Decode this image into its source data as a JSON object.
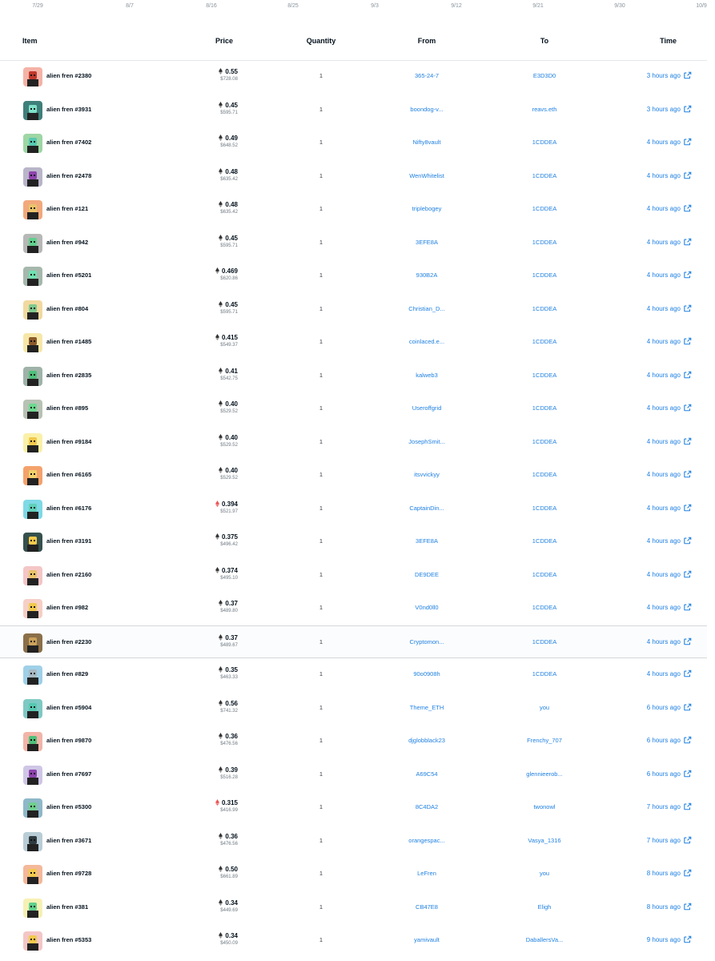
{
  "timeline_ticks": [
    "7/29",
    "8/7",
    "8/16",
    "8/25",
    "9/3",
    "9/12",
    "9/21",
    "9/30",
    "10/9"
  ],
  "table_headers": {
    "item": "Item",
    "price": "Price",
    "quantity": "Quantity",
    "from": "From",
    "to": "To",
    "time": "Time"
  },
  "icons": {
    "currency": "ethereum-icon",
    "link": "external-link-icon"
  },
  "colors": {
    "link": "#2081e2",
    "text": "#04111d",
    "muted": "#707a83",
    "eth_red": "#eb5757"
  },
  "rows": [
    {
      "item": "alien fren #2380",
      "eth": "0.55",
      "usd": "$728.08",
      "qty": "1",
      "from": "365-24-7",
      "to": "E3D3D0",
      "time": "3 hours ago",
      "bg": "#f4b3a6",
      "face": "#c0392b",
      "eth_red": false
    },
    {
      "item": "alien fren #3931",
      "eth": "0.45",
      "usd": "$595.71",
      "qty": "1",
      "from": "boondog-v...",
      "to": "reavs.eth",
      "time": "3 hours ago",
      "bg": "#3f7f7a",
      "face": "#7fe0c8",
      "eth_red": false
    },
    {
      "item": "alien fren #7402",
      "eth": "0.49",
      "usd": "$648.52",
      "qty": "1",
      "from": "Nifty8vault",
      "to": "1CDDEA",
      "time": "4 hours ago",
      "bg": "#9ed6a4",
      "face": "#56c8b0",
      "eth_red": false
    },
    {
      "item": "alien fren #2478",
      "eth": "0.48",
      "usd": "$635.42",
      "qty": "1",
      "from": "WenWhitelist",
      "to": "1CDDEA",
      "time": "4 hours ago",
      "bg": "#b9b5c9",
      "face": "#8e44ad",
      "eth_red": false
    },
    {
      "item": "alien fren #121",
      "eth": "0.48",
      "usd": "$635.42",
      "qty": "1",
      "from": "triplebogey",
      "to": "1CDDEA",
      "time": "4 hours ago",
      "bg": "#f2a97c",
      "face": "#e9c46a",
      "eth_red": false
    },
    {
      "item": "alien fren #942",
      "eth": "0.45",
      "usd": "$595.71",
      "qty": "1",
      "from": "3EFE8A",
      "to": "1CDDEA",
      "time": "4 hours ago",
      "bg": "#b5b8b5",
      "face": "#5fd08c",
      "eth_red": false
    },
    {
      "item": "alien fren #5201",
      "eth": "0.469",
      "usd": "$620.86",
      "qty": "1",
      "from": "930B2A",
      "to": "1CDDEA",
      "time": "4 hours ago",
      "bg": "#a6b8ad",
      "face": "#6fe0b0",
      "eth_red": false
    },
    {
      "item": "alien fren #804",
      "eth": "0.45",
      "usd": "$595.71",
      "qty": "1",
      "from": "Christian_D...",
      "to": "1CDDEA",
      "time": "4 hours ago",
      "bg": "#f1d9a0",
      "face": "#7ec98e",
      "eth_red": false
    },
    {
      "item": "alien fren #1485",
      "eth": "0.415",
      "usd": "$549.37",
      "qty": "1",
      "from": "coinlaced.e...",
      "to": "1CDDEA",
      "time": "4 hours ago",
      "bg": "#f6e7a8",
      "face": "#8b5a2b",
      "eth_red": false
    },
    {
      "item": "alien fren #2835",
      "eth": "0.41",
      "usd": "$542.75",
      "qty": "1",
      "from": "kalweb3",
      "to": "1CDDEA",
      "time": "4 hours ago",
      "bg": "#9fb3a8",
      "face": "#4fbf7a",
      "eth_red": false
    },
    {
      "item": "alien fren #895",
      "eth": "0.40",
      "usd": "$529.52",
      "qty": "1",
      "from": "Useroffgrid",
      "to": "1CDDEA",
      "time": "4 hours ago",
      "bg": "#b8c2b4",
      "face": "#6cd98f",
      "eth_red": false
    },
    {
      "item": "alien fren #9184",
      "eth": "0.40",
      "usd": "$529.52",
      "qty": "1",
      "from": "JosephSmit...",
      "to": "1CDDEA",
      "time": "4 hours ago",
      "bg": "#faf0a8",
      "face": "#f2c94c",
      "eth_red": false
    },
    {
      "item": "alien fren #6165",
      "eth": "0.40",
      "usd": "$529.52",
      "qty": "1",
      "from": "itsvvickyy",
      "to": "1CDDEA",
      "time": "4 hours ago",
      "bg": "#f4a26c",
      "face": "#f2d06b",
      "eth_red": false
    },
    {
      "item": "alien fren #6176",
      "eth": "0.394",
      "usd": "$521.97",
      "qty": "1",
      "from": "CaptainDin...",
      "to": "1CDDEA",
      "time": "4 hours ago",
      "bg": "#7fd9e6",
      "face": "#5fd0b8",
      "eth_red": true
    },
    {
      "item": "alien fren #3191",
      "eth": "0.375",
      "usd": "$496.42",
      "qty": "1",
      "from": "3EFE8A",
      "to": "1CDDEA",
      "time": "4 hours ago",
      "bg": "#35504d",
      "face": "#f2c94c",
      "eth_red": false
    },
    {
      "item": "alien fren #2160",
      "eth": "0.374",
      "usd": "$495.10",
      "qty": "1",
      "from": "DE9DEE",
      "to": "1CDDEA",
      "time": "4 hours ago",
      "bg": "#f4c6c6",
      "face": "#e9c46a",
      "eth_red": false
    },
    {
      "item": "alien fren #982",
      "eth": "0.37",
      "usd": "$489.80",
      "qty": "1",
      "from": "V0nd0ll0",
      "to": "1CDDEA",
      "time": "4 hours ago",
      "bg": "#f6cfc6",
      "face": "#f2c94c",
      "eth_red": false
    },
    {
      "item": "alien fren #2230",
      "eth": "0.37",
      "usd": "$489.67",
      "qty": "1",
      "from": "Cryptomon...",
      "to": "1CDDEA",
      "time": "4 hours ago",
      "bg": "#8a6f4a",
      "face": "#c9a15a",
      "eth_red": false
    },
    {
      "item": "alien fren #829",
      "eth": "0.35",
      "usd": "$463.33",
      "qty": "1",
      "from": "90o0908h",
      "to": "1CDDEA",
      "time": "4 hours ago",
      "bg": "#9fd0e8",
      "face": "#a9b8c2",
      "eth_red": false
    },
    {
      "item": "alien fren #5904",
      "eth": "0.56",
      "usd": "$741.32",
      "qty": "1",
      "from": "Theme_ETH",
      "to": "you",
      "time": "6 hours ago",
      "bg": "#7fc9c4",
      "face": "#56c8b0",
      "eth_red": false
    },
    {
      "item": "alien fren #9870",
      "eth": "0.36",
      "usd": "$476.56",
      "qty": "1",
      "from": "djglobblack23",
      "to": "Frenchy_707",
      "time": "6 hours ago",
      "bg": "#f2b4a8",
      "face": "#4fbf7a",
      "eth_red": false
    },
    {
      "item": "alien fren #7697",
      "eth": "0.39",
      "usd": "$516.28",
      "qty": "1",
      "from": "A69C54",
      "to": "glennieerob...",
      "time": "6 hours ago",
      "bg": "#cfc6e6",
      "face": "#8e44ad",
      "eth_red": false
    },
    {
      "item": "alien fren #5300",
      "eth": "0.315",
      "usd": "$416.99",
      "qty": "1",
      "from": "8C4DA2",
      "to": "twonowl",
      "time": "7 hours ago",
      "bg": "#8fb8c8",
      "face": "#6fd08c",
      "eth_red": true
    },
    {
      "item": "alien fren #3671",
      "eth": "0.36",
      "usd": "$476.56",
      "qty": "1",
      "from": "orangespac...",
      "to": "Vasya_1316",
      "time": "7 hours ago",
      "bg": "#b9cdd6",
      "face": "#2f3b40",
      "eth_red": false
    },
    {
      "item": "alien fren #9728",
      "eth": "0.50",
      "usd": "$661.89",
      "qty": "1",
      "from": "LeFren",
      "to": "you",
      "time": "8 hours ago",
      "bg": "#f4b89a",
      "face": "#f2c94c",
      "eth_red": false
    },
    {
      "item": "alien fren #381",
      "eth": "0.34",
      "usd": "$449.69",
      "qty": "1",
      "from": "CB47E8",
      "to": "Eligh",
      "time": "8 hours ago",
      "bg": "#f7f0b4",
      "face": "#5fd08c",
      "eth_red": false
    },
    {
      "item": "alien fren #5353",
      "eth": "0.34",
      "usd": "$450.09",
      "qty": "1",
      "from": "yamivault",
      "to": "DaballersVa...",
      "time": "9 hours ago",
      "bg": "#f4c6c6",
      "face": "#f2c94c",
      "eth_red": false
    }
  ]
}
